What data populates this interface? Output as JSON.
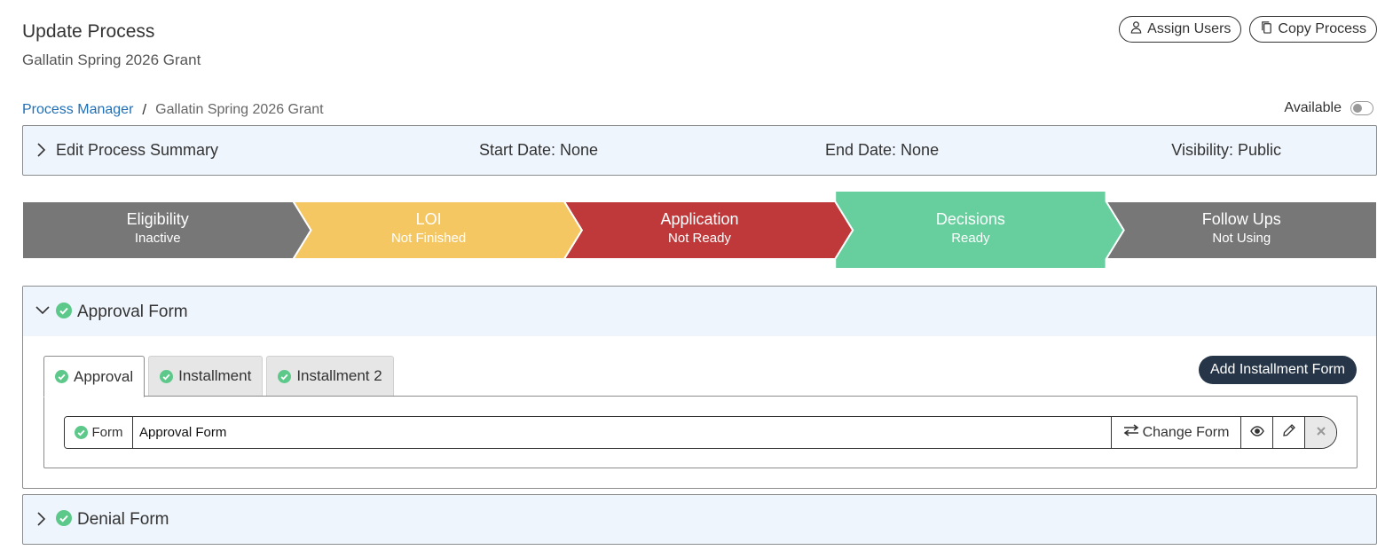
{
  "header": {
    "title": "Update Process",
    "subtitle": "Gallatin Spring 2026 Grant",
    "assign_users": "Assign Users",
    "copy_process": "Copy Process"
  },
  "breadcrumb": {
    "root": "Process Manager",
    "separator": "/",
    "current": "Gallatin Spring 2026 Grant"
  },
  "availability": {
    "label": "Available",
    "enabled": false
  },
  "summary": {
    "label": "Edit Process Summary",
    "start_date": "Start Date: None",
    "end_date": "End Date: None",
    "visibility": "Visibility: Public"
  },
  "stages": [
    {
      "name": "Eligibility",
      "status": "Inactive",
      "color": "#777777"
    },
    {
      "name": "LOI",
      "status": "Not Finished",
      "color": "#f4c762"
    },
    {
      "name": "Application",
      "status": "Not Ready",
      "color": "#c0393a"
    },
    {
      "name": "Decisions",
      "status": "Ready",
      "color": "#66cf9d",
      "selected": true
    },
    {
      "name": "Follow Ups",
      "status": "Not Using",
      "color": "#777777"
    }
  ],
  "approval_panel": {
    "title": "Approval Form",
    "tabs": [
      {
        "label": "Approval",
        "active": true
      },
      {
        "label": "Installment",
        "active": false
      },
      {
        "label": "Installment 2",
        "active": false
      }
    ],
    "add_button": "Add Installment Form",
    "form_row": {
      "addon_label": "Form",
      "value": "Approval Form",
      "change_label": "Change Form"
    }
  },
  "denial_panel": {
    "title": "Denial Form"
  },
  "colors": {
    "accent_link": "#1f6fb8",
    "check_green": "#5cc98a",
    "panel_bg": "#eff5fd",
    "dark_button": "#263547"
  }
}
